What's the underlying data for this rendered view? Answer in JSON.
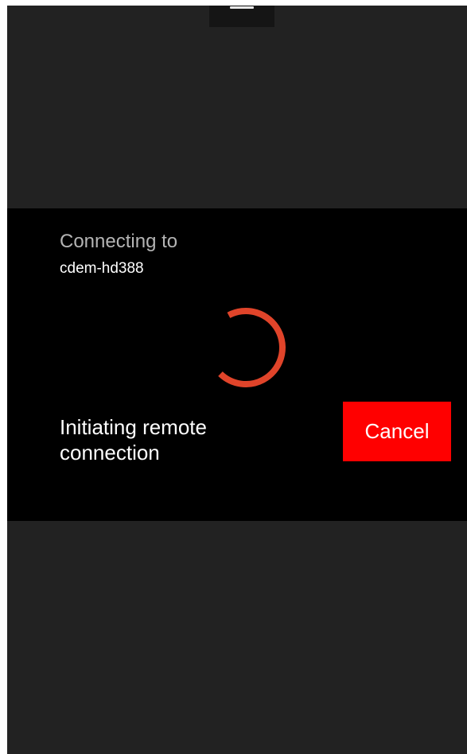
{
  "menu": {
    "icon": "menu-bar-icon"
  },
  "dialog": {
    "heading": "Connecting to",
    "host": "cdem-hd388",
    "spinner_icon": "loading-spinner-icon",
    "spinner_color": "#e0442a",
    "status": "Initiating remote connection",
    "cancel_label": "Cancel",
    "cancel_color": "#ff0000"
  }
}
